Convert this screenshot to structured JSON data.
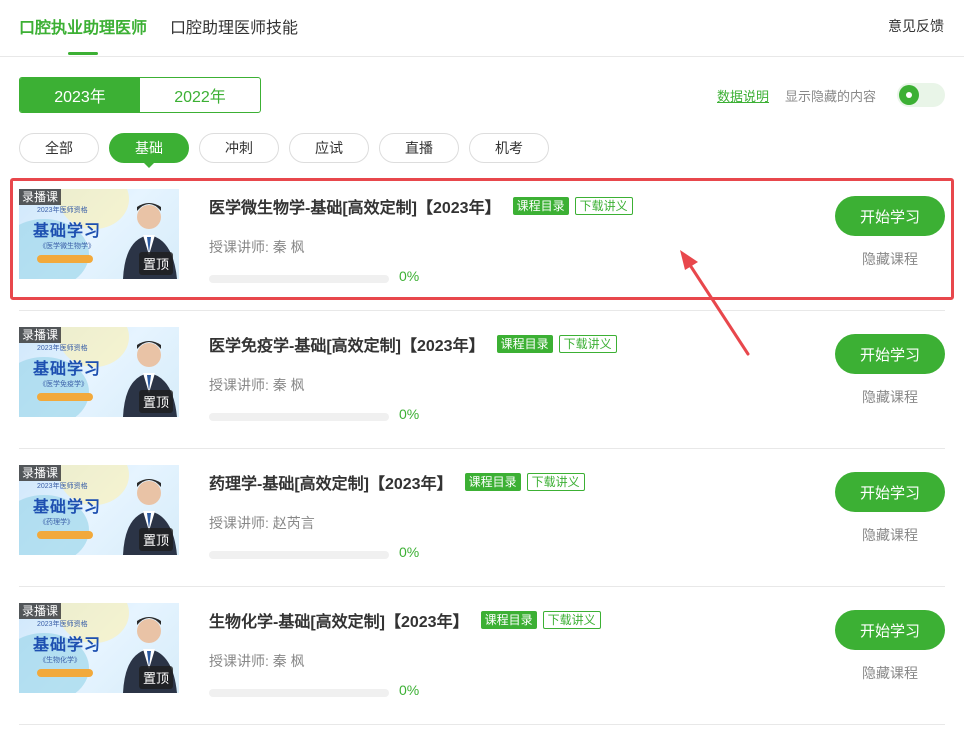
{
  "top_tabs": [
    {
      "label": "口腔执业助理医师",
      "active": true
    },
    {
      "label": "口腔助理医师技能",
      "active": false
    }
  ],
  "feedback_label": "意见反馈",
  "years": [
    {
      "label": "2023年",
      "active": true
    },
    {
      "label": "2022年",
      "active": false
    }
  ],
  "data_note": "数据说明",
  "show_hidden_label": "显示隐藏的内容",
  "show_hidden_on": true,
  "categories": [
    {
      "label": "全部",
      "active": false
    },
    {
      "label": "基础",
      "active": true
    },
    {
      "label": "冲刺",
      "active": false
    },
    {
      "label": "应试",
      "active": false
    },
    {
      "label": "直播",
      "active": false
    },
    {
      "label": "机考",
      "active": false
    }
  ],
  "courses": [
    {
      "badge": "录播课",
      "pin": "置顶",
      "thumb_sub": "2023年医师资格",
      "thumb_main": "基础学习",
      "thumb_course": "《医学微生物学》",
      "title": "医学微生物学-基础[高效定制]【2023年】",
      "catalog": "课程目录",
      "download": "下载讲义",
      "teacher": "授课讲师:  秦    枫",
      "progress": "0%",
      "progress_value": 0,
      "study": "开始学习",
      "hide": "隐藏课程"
    },
    {
      "badge": "录播课",
      "pin": "置顶",
      "thumb_sub": "2023年医师资格",
      "thumb_main": "基础学习",
      "thumb_course": "《医学免疫学》",
      "title": "医学免疫学-基础[高效定制]【2023年】",
      "catalog": "课程目录",
      "download": "下载讲义",
      "teacher": "授课讲师:  秦    枫",
      "progress": "0%",
      "progress_value": 0,
      "study": "开始学习",
      "hide": "隐藏课程"
    },
    {
      "badge": "录播课",
      "pin": "置顶",
      "thumb_sub": "2023年医师资格",
      "thumb_main": "基础学习",
      "thumb_course": "《药理学》",
      "title": "药理学-基础[高效定制]【2023年】",
      "catalog": "课程目录",
      "download": "下载讲义",
      "teacher": "授课讲师:  赵芮言",
      "progress": "0%",
      "progress_value": 0,
      "study": "开始学习",
      "hide": "隐藏课程"
    },
    {
      "badge": "录播课",
      "pin": "置顶",
      "thumb_sub": "2023年医师资格",
      "thumb_main": "基础学习",
      "thumb_course": "《生物化学》",
      "title": "生物化学-基础[高效定制]【2023年】",
      "catalog": "课程目录",
      "download": "下载讲义",
      "teacher": "授课讲师:  秦    枫",
      "progress": "0%",
      "progress_value": 0,
      "study": "开始学习",
      "hide": "隐藏课程"
    }
  ],
  "colors": {
    "accent": "#3cb034",
    "annotation": "#e8474c"
  }
}
